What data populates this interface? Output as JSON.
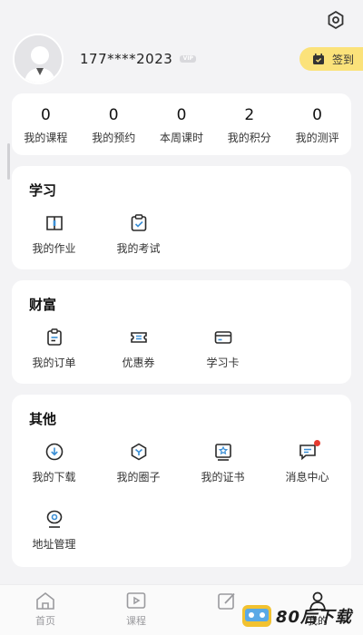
{
  "header": {
    "settings_icon": "settings-icon"
  },
  "profile": {
    "phone": "177****2023",
    "vip_label": "VIP",
    "checkin_label": "签到"
  },
  "stats": [
    {
      "value": "0",
      "label": "我的课程"
    },
    {
      "value": "0",
      "label": "我的预约"
    },
    {
      "value": "0",
      "label": "本周课时"
    },
    {
      "value": "2",
      "label": "我的积分"
    },
    {
      "value": "0",
      "label": "我的测评"
    }
  ],
  "study": {
    "title": "学习",
    "items": [
      {
        "label": "我的作业",
        "icon": "homework-icon"
      },
      {
        "label": "我的考试",
        "icon": "exam-icon"
      }
    ]
  },
  "wealth": {
    "title": "财富",
    "items": [
      {
        "label": "我的订单",
        "icon": "order-icon"
      },
      {
        "label": "优惠券",
        "icon": "coupon-icon"
      },
      {
        "label": "学习卡",
        "icon": "study-card-icon"
      }
    ]
  },
  "other": {
    "title": "其他",
    "items": [
      {
        "label": "我的下载",
        "icon": "download-icon"
      },
      {
        "label": "我的圈子",
        "icon": "circle-icon"
      },
      {
        "label": "我的证书",
        "icon": "certificate-icon"
      },
      {
        "label": "消息中心",
        "icon": "message-icon"
      },
      {
        "label": "地址管理",
        "icon": "location-icon"
      }
    ]
  },
  "tabbar": [
    {
      "label": "首页",
      "icon": "home-icon",
      "active": false
    },
    {
      "label": "课程",
      "icon": "course-play-icon",
      "active": false
    },
    {
      "label": "",
      "icon": "edit-icon",
      "active": false
    },
    {
      "label": "我的",
      "icon": "profile-icon",
      "active": true
    }
  ],
  "watermark": {
    "text": "80后下载"
  },
  "colors": {
    "accent": "#fbe27a",
    "badge": "#e63b30",
    "background": "#f3f3f5"
  }
}
